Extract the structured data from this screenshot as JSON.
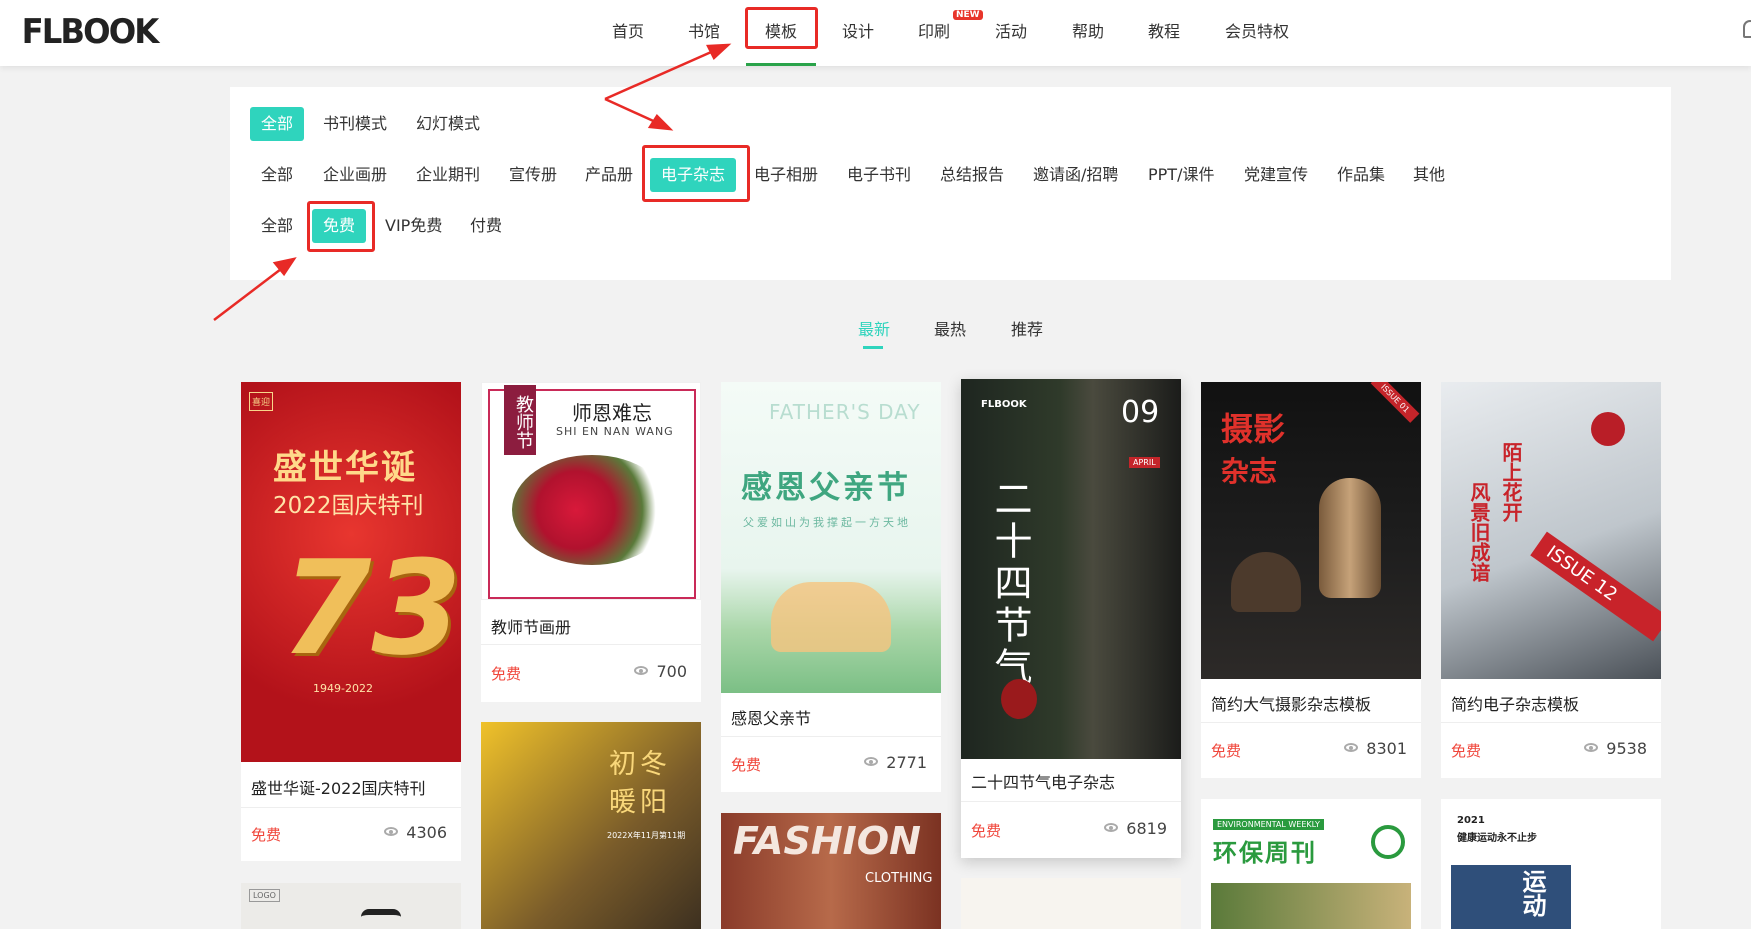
{
  "logo": {
    "text": "FLBOOK"
  },
  "nav": {
    "items": [
      "首页",
      "书馆",
      "模板",
      "设计",
      "印刷",
      "活动",
      "帮助",
      "教程",
      "会员特权"
    ],
    "new_badge": "NEW",
    "active_index": 2
  },
  "filters": {
    "mode": [
      "全部",
      "书刊模式",
      "幻灯模式"
    ],
    "category": [
      "全部",
      "企业画册",
      "企业期刊",
      "宣传册",
      "产品册",
      "电子杂志",
      "电子相册",
      "电子书刊",
      "总结报告",
      "邀请函/招聘",
      "PPT/课件",
      "党建宣传",
      "作品集",
      "其他"
    ],
    "price": [
      "全部",
      "免费",
      "VIP免费",
      "付费"
    ],
    "active_mode": "全部",
    "active_category": "电子杂志",
    "active_price": "免费"
  },
  "sort": {
    "tabs": [
      "最新",
      "最热",
      "推荐"
    ],
    "active": "最新"
  },
  "cards": [
    {
      "title": "盛世华诞-2022国庆特刊",
      "price": "免费",
      "views": "4306",
      "cover": {
        "line1": "盛世华诞",
        "line2": "2022国庆特刊",
        "big": "73",
        "years": "1949-2022",
        "corner": "喜迎",
        "bg": "#c8171c"
      }
    },
    {
      "title": "教师节画册",
      "price": "免费",
      "views": "700",
      "cover": {
        "badge": "教师节",
        "heading": "师恩难忘",
        "sub": "SHI EN NAN WANG",
        "bg": "#ffffff"
      }
    },
    {
      "title": "感恩父亲节",
      "price": "免费",
      "views": "2771",
      "cover": {
        "en": "FATHER'S DAY",
        "heading": "感恩父亲节",
        "sub": "父爱如山为我撑起一方天地",
        "bg": "#eef7f1"
      }
    },
    {
      "title": "二十四节气电子杂志",
      "price": "免费",
      "views": "6819",
      "cover": {
        "brand": "FLBOOK",
        "num": "09",
        "heading": "二十四节气",
        "tag": "APRIL",
        "bg": "#2b3328"
      }
    },
    {
      "title": "简约大气摄影杂志模板",
      "price": "免费",
      "views": "8301",
      "cover": {
        "heading1": "摄影",
        "heading2": "杂志",
        "issue": "ISSUE 01",
        "bg": "#151515"
      }
    },
    {
      "title": "简约电子杂志模板",
      "price": "免费",
      "views": "9538",
      "cover": {
        "heading": "陌上花开",
        "heading2": "风景旧成谙",
        "issue": "ISSUE 12",
        "bg": "#cfd3d8"
      }
    }
  ],
  "second_row": {
    "c2": {
      "heading1": "初冬",
      "heading2": "暖阳",
      "date": "2022X年11月第11期"
    },
    "c3": {
      "heading": "FASHION",
      "sub": "CLOTHING"
    },
    "c5": {
      "tag": "ENVIRONMENTAL WEEKLY",
      "heading": "环保周刊"
    },
    "c6": {
      "year": "2021",
      "heading": "健康运动永不止步",
      "vert": "运动"
    },
    "c1": {
      "logo": "LOGO"
    }
  },
  "colors": {
    "accent": "#2fd4bd",
    "price": "#f0463b",
    "annotation": "#e82a26"
  }
}
